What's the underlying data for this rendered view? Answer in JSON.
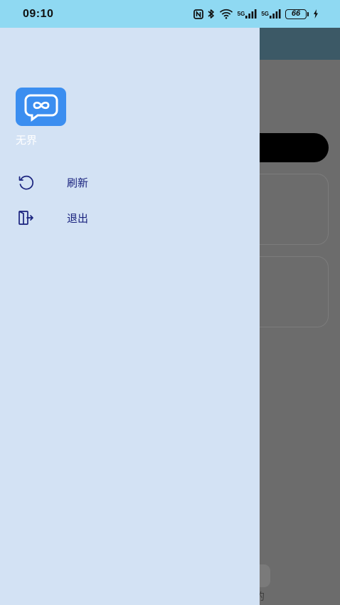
{
  "status_bar": {
    "time": "09:10",
    "signal1_label": "5G",
    "signal2_label": "5G",
    "battery_level": "66"
  },
  "drawer": {
    "app_name": "无界",
    "menu": [
      {
        "label": "刷新",
        "icon": "refresh-icon"
      },
      {
        "label": "退出",
        "icon": "exit-icon"
      }
    ]
  },
  "background": {
    "nav_label_partial": "的"
  },
  "colors": {
    "status_bar": "#8fd9f2",
    "drawer_bg": "#d3e2f4",
    "logo_bg": "#3b8ef0",
    "menu_text": "#1a237e",
    "scrim": "#6c6c6c",
    "bg_header": "#3c5966"
  }
}
